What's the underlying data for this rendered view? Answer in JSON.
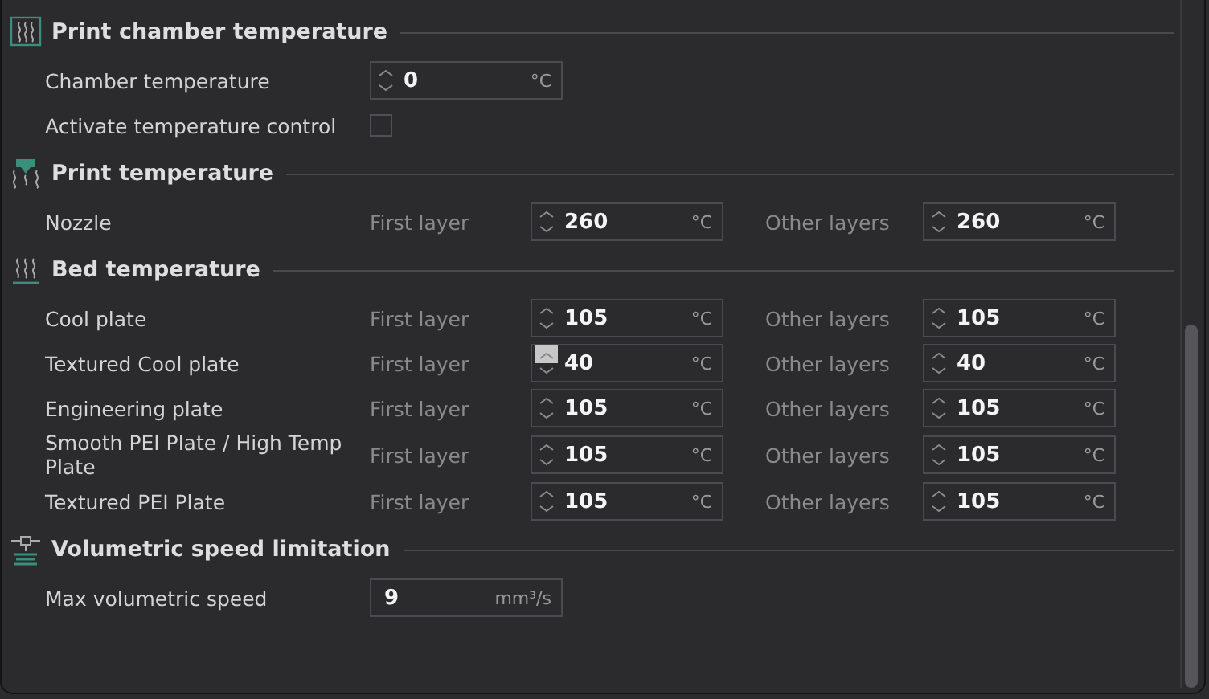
{
  "sections": [
    {
      "title": "Print chamber temperature",
      "rows": [
        {
          "kind": "field",
          "label": "Chamber temperature",
          "field": {
            "kind": "spin",
            "value": "0",
            "unit": "°C",
            "up_highlighted": false
          }
        },
        {
          "kind": "checkbox",
          "label": "Activate temperature control",
          "checked": false
        }
      ]
    },
    {
      "title": "Print temperature",
      "rows": [
        {
          "kind": "layers",
          "label": "Nozzle",
          "first_label": "First layer",
          "first": {
            "kind": "spin",
            "value": "260",
            "unit": "°C",
            "up_highlighted": false
          },
          "other_label": "Other layers",
          "other": {
            "kind": "spin",
            "value": "260",
            "unit": "°C",
            "up_highlighted": false
          }
        }
      ]
    },
    {
      "title": "Bed temperature",
      "rows": [
        {
          "kind": "layers",
          "label": "Cool plate",
          "first_label": "First layer",
          "first": {
            "kind": "spin",
            "value": "105",
            "unit": "°C",
            "up_highlighted": false
          },
          "other_label": "Other layers",
          "other": {
            "kind": "spin",
            "value": "105",
            "unit": "°C",
            "up_highlighted": false
          }
        },
        {
          "kind": "layers",
          "label": "Textured Cool plate",
          "first_label": "First layer",
          "first": {
            "kind": "spin",
            "value": "40",
            "unit": "°C",
            "up_highlighted": true
          },
          "other_label": "Other layers",
          "other": {
            "kind": "spin",
            "value": "40",
            "unit": "°C",
            "up_highlighted": false
          }
        },
        {
          "kind": "layers",
          "label": "Engineering plate",
          "first_label": "First layer",
          "first": {
            "kind": "spin",
            "value": "105",
            "unit": "°C",
            "up_highlighted": false
          },
          "other_label": "Other layers",
          "other": {
            "kind": "spin",
            "value": "105",
            "unit": "°C",
            "up_highlighted": false
          }
        },
        {
          "kind": "layers",
          "label": "Smooth PEI Plate / High Temp Plate",
          "first_label": "First layer",
          "first": {
            "kind": "spin",
            "value": "105",
            "unit": "°C",
            "up_highlighted": false
          },
          "other_label": "Other layers",
          "other": {
            "kind": "spin",
            "value": "105",
            "unit": "°C",
            "up_highlighted": false
          }
        },
        {
          "kind": "layers",
          "label": "Textured PEI Plate",
          "first_label": "First layer",
          "first": {
            "kind": "spin",
            "value": "105",
            "unit": "°C",
            "up_highlighted": false
          },
          "other_label": "Other layers",
          "other": {
            "kind": "spin",
            "value": "105",
            "unit": "°C",
            "up_highlighted": false
          }
        }
      ]
    },
    {
      "title": "Volumetric speed limitation",
      "rows": [
        {
          "kind": "field",
          "label": "Max volumetric speed",
          "field": {
            "kind": "plain",
            "value": "9",
            "unit": "mm³/s"
          }
        }
      ]
    }
  ]
}
